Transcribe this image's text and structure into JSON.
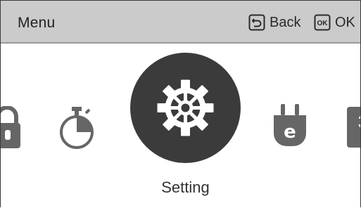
{
  "header": {
    "title": "Menu",
    "back_label": "Back",
    "ok_icon_text": "OK",
    "ok_label": "OK"
  },
  "menu": {
    "items": [
      {
        "icon": "lock-icon"
      },
      {
        "icon": "timer-icon"
      },
      {
        "icon": "gear-icon",
        "selected": true,
        "label": "Setting"
      },
      {
        "icon": "energy-plug-icon"
      },
      {
        "icon": "partial-menu-icon"
      }
    ],
    "selected_label": "Setting"
  },
  "colors": {
    "header_bg": "#cbcbcb",
    "icon_gray": "#666666",
    "selected_circle": "#3b3b3b",
    "text": "#333333"
  }
}
